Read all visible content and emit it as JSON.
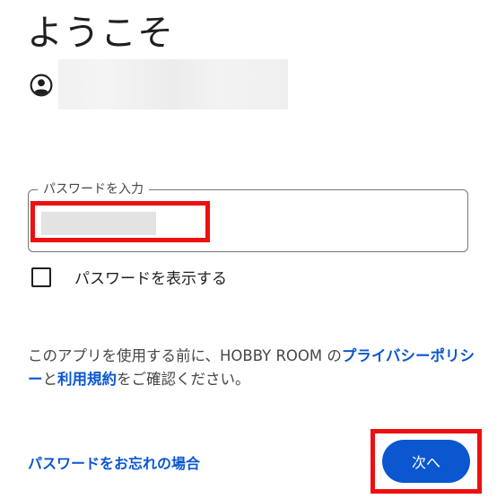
{
  "page": {
    "title": "ようこそ"
  },
  "account": {
    "icon": "account-circle-icon"
  },
  "password": {
    "label": "パスワードを入力",
    "value": ""
  },
  "show_password": {
    "label": "パスワードを表示する",
    "checked": false
  },
  "terms": {
    "before": "このアプリを使用する前に、HOBBY ROOM の",
    "privacy_link": "プライバシーポリシー",
    "middle": "と",
    "terms_link": "利用規約",
    "after": "をご確認ください。"
  },
  "actions": {
    "forgot_password": "パスワードをお忘れの場合",
    "next_label": "次へ"
  },
  "colors": {
    "accent": "#0b57d0",
    "highlight": "#ee1010",
    "text": "#1f1f1f"
  }
}
